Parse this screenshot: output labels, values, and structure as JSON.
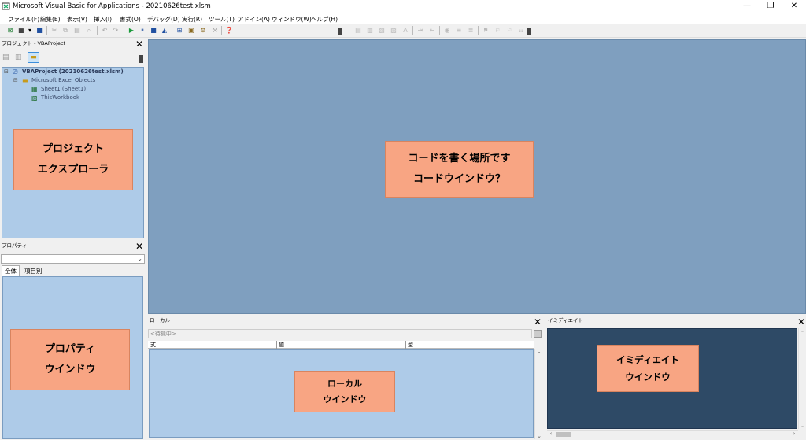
{
  "window": {
    "title": "Microsoft Visual Basic for Applications - 20210626test.xlsm",
    "minimize": "—",
    "restore": "❐",
    "close": "✕"
  },
  "menu": [
    "ファイル(F)",
    "編集(E)",
    "表示(V)",
    "挿入(I)",
    "書式(O)",
    "デバッグ(D)",
    "実行(R)",
    "ツール(T)",
    "アドイン(A)",
    "ウィンドウ(W)",
    "ヘルプ(H)"
  ],
  "project_explorer": {
    "title": "プロジェクト - VBAProject",
    "tree": {
      "root": "VBAProject (20210626test.xlsm)",
      "folder": "Microsoft Excel Objects",
      "items": [
        "Sheet1 (Sheet1)",
        "ThisWorkbook"
      ]
    },
    "callout_line1": "プロジェクト",
    "callout_line2": "エクスプローラ"
  },
  "properties": {
    "title": "プロパティ",
    "tab_all": "全体",
    "tab_category": "項目別",
    "callout_line1": "プロパティ",
    "callout_line2": "ウインドウ"
  },
  "code_window": {
    "callout_line1": "コードを書く場所です",
    "callout_line2": "コードウインドウ？",
    "background": "#7f9fbf"
  },
  "locals": {
    "title": "ローカル",
    "status": "<待機中>",
    "col_expression": "式",
    "col_value": "値",
    "col_type": "型",
    "callout_line1": "ローカル",
    "callout_line2": "ウインドウ"
  },
  "immediate": {
    "title": "イミディエイト",
    "callout_line1": "イミディエイト",
    "callout_line2": "ウインドウ",
    "background": "#2e4a66"
  },
  "colors": {
    "pane_blue": "#aecbe8",
    "callout": "#f8a583"
  }
}
